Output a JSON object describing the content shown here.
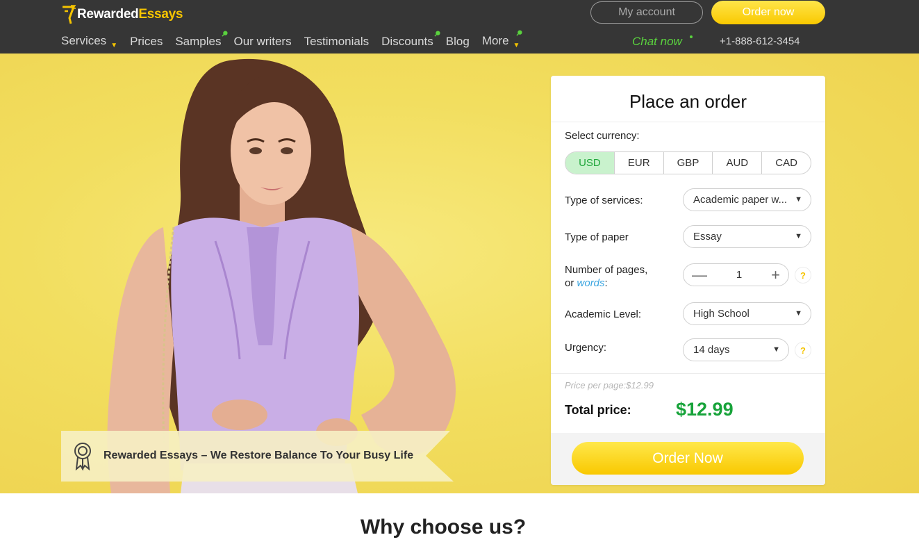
{
  "brand": {
    "name_white": "Rewarded",
    "name_yellow": "Essays"
  },
  "header": {
    "account_label": "My account",
    "order_label": "Order now",
    "nav": [
      {
        "label": "Services",
        "has_caret": true
      },
      {
        "label": "Prices"
      },
      {
        "label": "Samples",
        "pin": true
      },
      {
        "label": "Our writers"
      },
      {
        "label": "Testimonials"
      },
      {
        "label": "Discounts",
        "pin": true
      },
      {
        "label": "Blog"
      },
      {
        "label": "More",
        "has_caret": true,
        "pin": true
      }
    ],
    "chat_label": "Chat now",
    "phone": "+1-888-612-3454",
    "icons": [
      "logo-icon",
      "chevron-down-icon",
      "pin-icon"
    ]
  },
  "hero": {
    "banner_text": "Rewarded Essays – We Restore Balance To Your Busy Life",
    "banner_icon": "award-ribbon-icon"
  },
  "order_form": {
    "title": "Place an order",
    "currency_label": "Select currency:",
    "currencies": [
      "USD",
      "EUR",
      "GBP",
      "AUD",
      "CAD"
    ],
    "selected_currency": "USD",
    "service_label": "Type of services:",
    "service_value": "Academic paper w...",
    "paper_label": "Type of paper",
    "paper_value": "Essay",
    "pages_label": "Number of pages,",
    "pages_or": "or",
    "pages_words": "words",
    "pages_colon": ":",
    "pages_value": "1",
    "level_label": "Academic Level:",
    "level_value": "High School",
    "urgency_label": "Urgency:",
    "urgency_value": "14 days",
    "help_symbol": "?",
    "price_per_page": "Price per page:$12.99",
    "total_label": "Total price:",
    "total_value": "$12.99",
    "order_button": "Order Now"
  },
  "section": {
    "why_title": "Why choose us?"
  },
  "colors": {
    "header_bg": "#363636",
    "accent_yellow": "#f5c400",
    "hero_yellow": "#f2de5f",
    "green": "#17a33a",
    "chat_green": "#5ad23e",
    "active_currency_bg": "#c9f2cd"
  }
}
